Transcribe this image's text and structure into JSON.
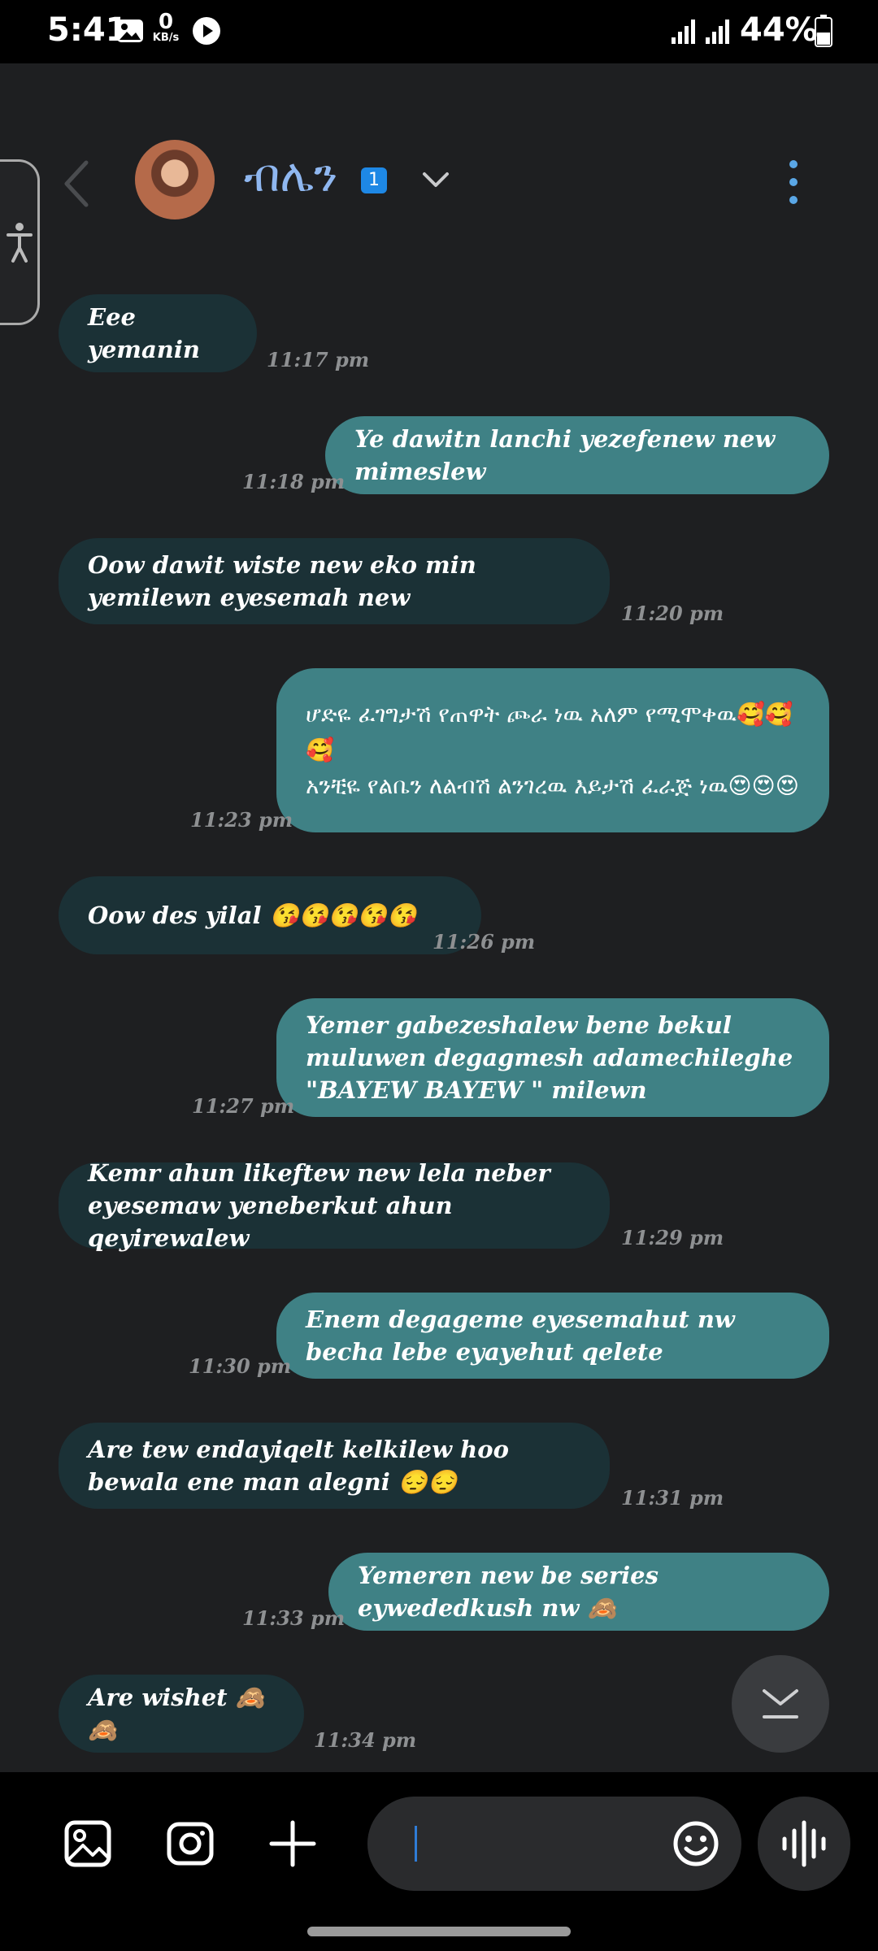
{
  "status_bar": {
    "time": "5:41",
    "net_speed_value": "0",
    "net_speed_unit": "KB/s",
    "battery": "44%"
  },
  "header": {
    "contact_name": "ብሌን",
    "badge_count": "1"
  },
  "messages": [
    {
      "side": "in",
      "text": "Eee yemanin",
      "time": "11:17 pm"
    },
    {
      "side": "out",
      "text": "Ye dawitn lanchi yezefenew new mimeslew",
      "time": "11:18 pm"
    },
    {
      "side": "in",
      "text": "Oow dawit wiste new eko min yemilewn eyesemah new",
      "time": "11:20 pm"
    },
    {
      "side": "out",
      "text": "ሆድዬ ፈገግታሽ የጠዋት ጮራ ነዉ አለም የሚሞቀዉ🥰🥰🥰\nአንቺዬ የልቤን ለልብሽ ልንገረዉ እይታሽ ፈራጅ ነዉ😍😍😍",
      "time": "11:23 pm"
    },
    {
      "side": "in",
      "text": "Oow des yilal 😘😘😘😘😘",
      "time": "11:26 pm"
    },
    {
      "side": "out",
      "text": "Yemer gabezeshalew bene bekul muluwen degagmesh adamechileghe \"BAYEW BAYEW \" milewn",
      "time": "11:27 pm"
    },
    {
      "side": "in",
      "text": "Kemr ahun likeftew new lela neber eyesemaw yeneberkut ahun qeyirewalew",
      "time": "11:29 pm"
    },
    {
      "side": "out",
      "text": "Enem degageme eyesemahut nw becha lebe eyayehut qelete",
      "time": "11:30 pm"
    },
    {
      "side": "in",
      "text": "Are tew endayiqelt kelkilew hoo bewala ene man alegni 😔😔",
      "time": "11:31 pm"
    },
    {
      "side": "out",
      "text": "Yemeren new be series eywededkush nw 🙈",
      "time": "11:33 pm"
    },
    {
      "side": "in",
      "text": "Are wishet 🙈🙈",
      "time": "11:34 pm"
    }
  ],
  "input": {
    "placeholder": ""
  }
}
